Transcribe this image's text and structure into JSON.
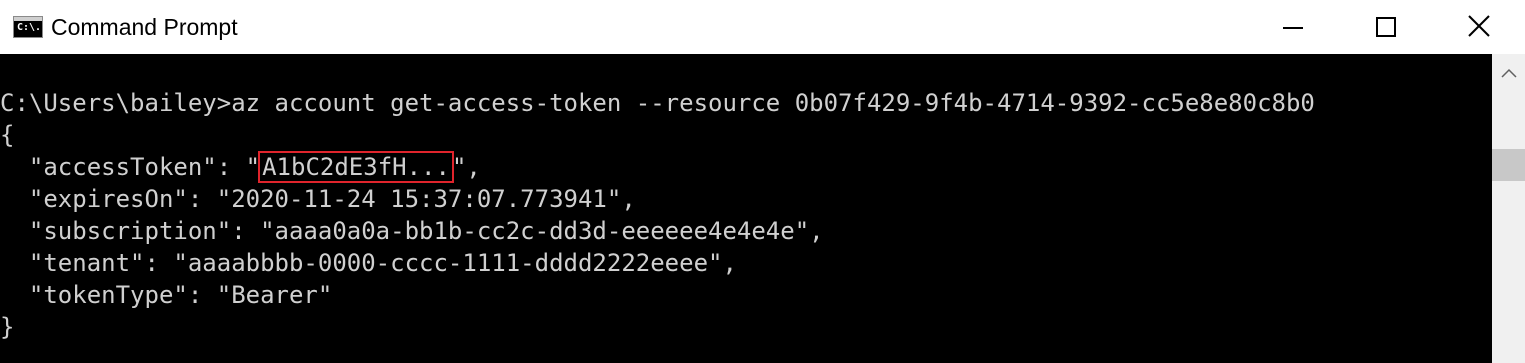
{
  "window": {
    "title": "Command Prompt",
    "icon_name": "cmd-icon",
    "icon_text": "C:\\.",
    "controls": {
      "minimize_icon": "minimize-icon",
      "maximize_icon": "maximize-icon",
      "close_icon": "close-icon"
    }
  },
  "console": {
    "prompt": "C:\\Users\\bailey>",
    "command": "az account get-access-token --resource 0b07f429-9f4b-4714-9392-cc5e8e80c8b0",
    "output": {
      "open_brace": "{",
      "access_token_key": "  \"accessToken\": \"",
      "access_token_value": "A1bC2dE3fH...",
      "access_token_suffix": "\",",
      "expires_on_line": "  \"expiresOn\": \"2020-11-24 15:37:07.773941\",",
      "subscription_line": "  \"subscription\": \"aaaa0a0a-bb1b-cc2c-dd3d-eeeeee4e4e4e\",",
      "tenant_line": "  \"tenant\": \"aaaabbbb-0000-cccc-1111-dddd2222eeee\",",
      "token_type_line": "  \"tokenType\": \"Bearer\"",
      "close_brace": "}"
    },
    "text_color": "#d0d0d0",
    "background": "#000000",
    "highlight_color": "#e0242c"
  }
}
